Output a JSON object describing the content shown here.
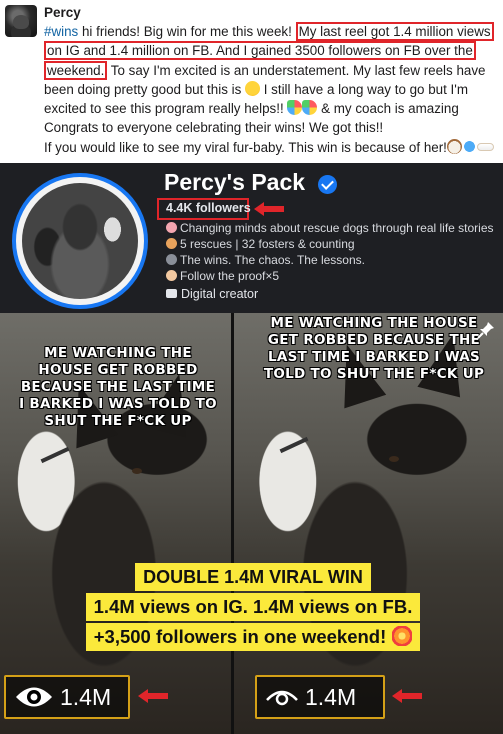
{
  "post": {
    "author": "Percy",
    "hashtag": "#wins",
    "text_intro": " hi friends! Big win for me this week! ",
    "highlight_a": "My last reel got 1.4 million views on IG and 1.4 million on FB. And I gained 3500 followers on FB over the",
    "highlight_b": "weekend.",
    "text_rest": " To say I'm excited is an understatement. My last few reels have been doing pretty good but this is ",
    "text_rest_2": " I still have a long way to go but I'm excited to see this program really helps!! ",
    "text_rest_3": " & my coach is amazing",
    "line_congrats": "Congrats to everyone celebrating their wins! We got this!!",
    "line_furbaby": "If you would like to see my viral fur-baby. This win is because of her!"
  },
  "profile": {
    "name": "Percy's Pack",
    "followers": "4.4K followers",
    "bio": [
      "Changing minds about rescue dogs through real life stories",
      "5 rescues | 32 fosters & counting",
      "The wins. The chaos. The lessons.",
      "Follow the proof×5"
    ],
    "category": "Digital creator"
  },
  "reels": {
    "left_caption": "ME WATCHING THE HOUSE GET ROBBED BECAUSE THE LAST TIME I BARKED I WAS TOLD TO SHUT THE F*CK UP",
    "right_caption": "ME WATCHING THE HOUSE GET ROBBED BECAUSE THE LAST TIME I BARKED I WAS TOLD TO SHUT THE F*CK UP",
    "left_views": "1.4M",
    "right_views": "1.4M"
  },
  "banner": {
    "line1": "DOUBLE 1.4M VIRAL WIN",
    "line2": "1.4M views on IG. 1.4M views on FB.",
    "line3": "+3,500 followers in one weekend!"
  },
  "colors": {
    "highlight_red": "#e0252a",
    "banner_yellow": "#fbe93b",
    "views_border": "#d4a017",
    "facebook_blue": "#1877f2",
    "profile_bg": "#1e1f23"
  }
}
